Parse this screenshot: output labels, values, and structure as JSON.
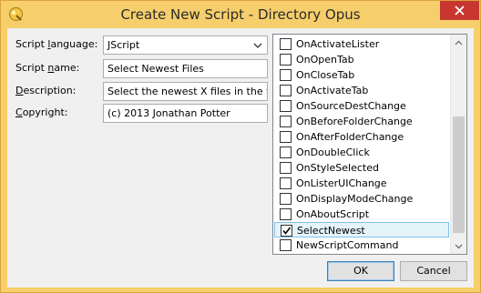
{
  "window": {
    "title": "Create New Script - Directory Opus",
    "icon": "directory-opus-app-icon",
    "close_icon": "close-icon",
    "accent_color": "#f6ce6b",
    "close_color": "#c7372f"
  },
  "form": {
    "language": {
      "label_pre": "Script ",
      "label_key": "l",
      "label_post": "anguage:",
      "value": "JScript",
      "icon": "chevron-down-icon"
    },
    "name": {
      "label_pre": "Script ",
      "label_key": "n",
      "label_post": "ame:",
      "value": "Select Newest Files"
    },
    "description": {
      "label_key": "D",
      "label_post": "escription:",
      "value": "Select the newest X files in the fo"
    },
    "copyright": {
      "label_key": "C",
      "label_post": "opyright:",
      "value": "(c) 2013 Jonathan Potter"
    }
  },
  "events": {
    "items": [
      {
        "label": "OnActivateLister",
        "checked": false
      },
      {
        "label": "OnOpenTab",
        "checked": false
      },
      {
        "label": "OnCloseTab",
        "checked": false
      },
      {
        "label": "OnActivateTab",
        "checked": false
      },
      {
        "label": "OnSourceDestChange",
        "checked": false
      },
      {
        "label": "OnBeforeFolderChange",
        "checked": false
      },
      {
        "label": "OnAfterFolderChange",
        "checked": false
      },
      {
        "label": "OnDoubleClick",
        "checked": false
      },
      {
        "label": "OnStyleSelected",
        "checked": false
      },
      {
        "label": "OnListerUIChange",
        "checked": false
      },
      {
        "label": "OnDisplayModeChange",
        "checked": false
      },
      {
        "label": "OnAboutScript",
        "checked": false
      },
      {
        "label": "SelectNewest",
        "checked": true,
        "selected": true
      },
      {
        "label": "NewScriptCommand",
        "checked": false
      }
    ],
    "scroll_up_icon": "chevron-up-icon",
    "scroll_down_icon": "chevron-down-icon"
  },
  "buttons": {
    "ok": "OK",
    "cancel": "Cancel"
  }
}
